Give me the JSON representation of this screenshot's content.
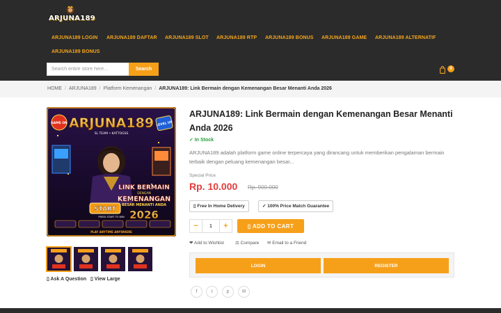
{
  "header": {
    "logo_text": "ARJUNA189",
    "nav": [
      "ARJUNA189 LOGIN",
      "ARJUNA189 DAFTAR",
      "ARJUNA189 SLOT",
      "ARJUNA189 RTP",
      "ARJUNA189 BONUS",
      "ARJUNA189 GAME",
      "ARJUNA189 ALTERNATIF",
      "ARJUNA189 BONUS"
    ],
    "search": {
      "placeholder": "Search entire store here...",
      "button_label": "Search"
    },
    "cart": {
      "icon": "shopping-bag-icon",
      "count": "0"
    }
  },
  "breadcrumb": {
    "items": [
      "HOME",
      "ARJUNA189",
      "Platform Kemenangan"
    ],
    "current": "ARJUNA189: Link Bermain dengan Kemenangan Besar Menanti Anda 2026"
  },
  "product_image": {
    "banner_title": "ARJUNA189",
    "banner_subtitle": "SL TEAM • KATTOGSS",
    "badge_left": "GAME ON",
    "badge_right": "LEVEL UP",
    "headline_1": "LINK BERMAIN",
    "headline_2": "DENGAN",
    "headline_3": "KEMENANGAN",
    "headline_4": "BESAR MENANTI ANDA",
    "year": "2026",
    "start_label": "START",
    "press_text": "PRESS START TO WIN",
    "footer_text": "PLAY ANYTIME ANYWHERE"
  },
  "image_links": {
    "ask": "Ask A Question",
    "view": "View Large"
  },
  "product": {
    "title": "ARJUNA189: Link Bermain dengan Kemenangan Besar Menanti Anda 2026",
    "stock": "✓ In Stock",
    "description": "ARJUNA189 adalah platform game online terpercaya yang dirancang untuk memberikan pengalaman bermain terbaik dengan peluang kemenangan besar...",
    "price_label": "Special Price",
    "price": "Rp. 10.000",
    "old_price": "Rp. 900.000",
    "badges": [
      "Free In Home Delivery",
      "✓ 100% Price Match Guarantee"
    ],
    "qty": "1",
    "qty_minus": "−",
    "qty_plus": "+",
    "add_to_cart": "ADD TO CART",
    "actions": [
      "❤ Add to Wishlist",
      "⚖ Compare",
      "✉ Email to a Friend"
    ],
    "login_label": "LOGIN",
    "register_label": "REGISTER",
    "share": [
      "f",
      "t",
      "p",
      "✉"
    ]
  },
  "colors": {
    "accent": "#f6a01a",
    "header_bg": "#2b2b2b",
    "price": "#e23b3b",
    "stock": "#2a9d3c"
  }
}
